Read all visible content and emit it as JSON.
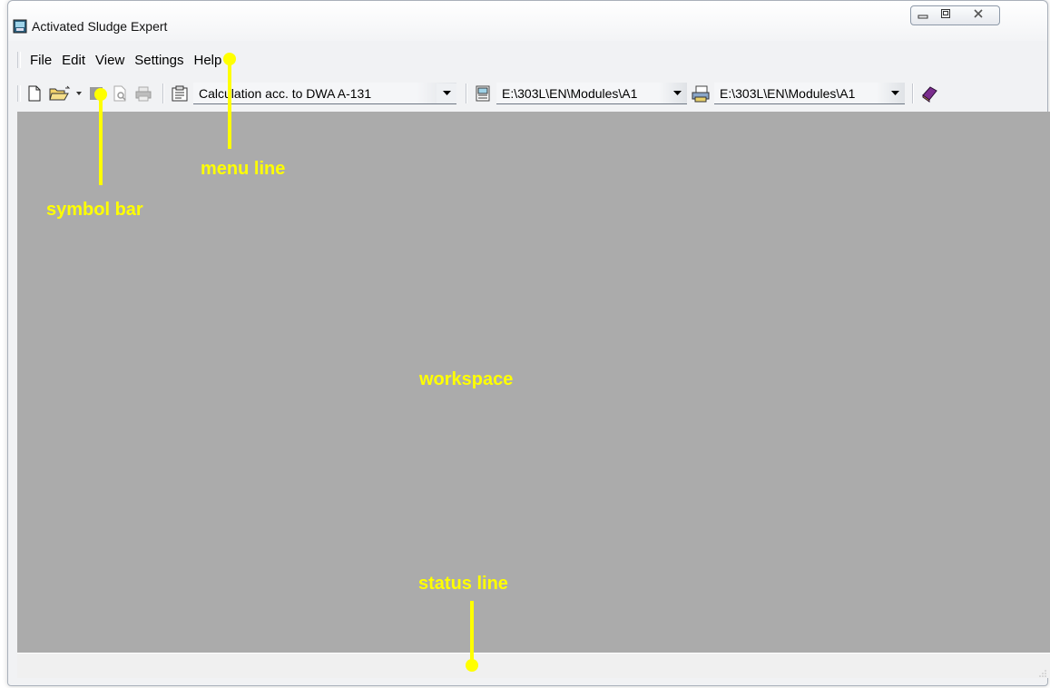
{
  "window": {
    "title": "Activated Sludge Expert"
  },
  "menu": {
    "items": [
      "File",
      "Edit",
      "View",
      "Settings",
      "Help"
    ]
  },
  "toolbar": {
    "calc_combo": "Calculation acc. to DWA A-131",
    "path_combo_1": "E:\\303L\\EN\\Modules\\A1",
    "path_combo_2": "E:\\303L\\EN\\Modules\\A1"
  },
  "annotations": {
    "menu_line": "menu line",
    "symbol_bar": "symbol bar",
    "workspace": "workspace",
    "status_line": "status line"
  },
  "colors": {
    "annotation": "#ffff00",
    "workspace": "#ababab"
  }
}
